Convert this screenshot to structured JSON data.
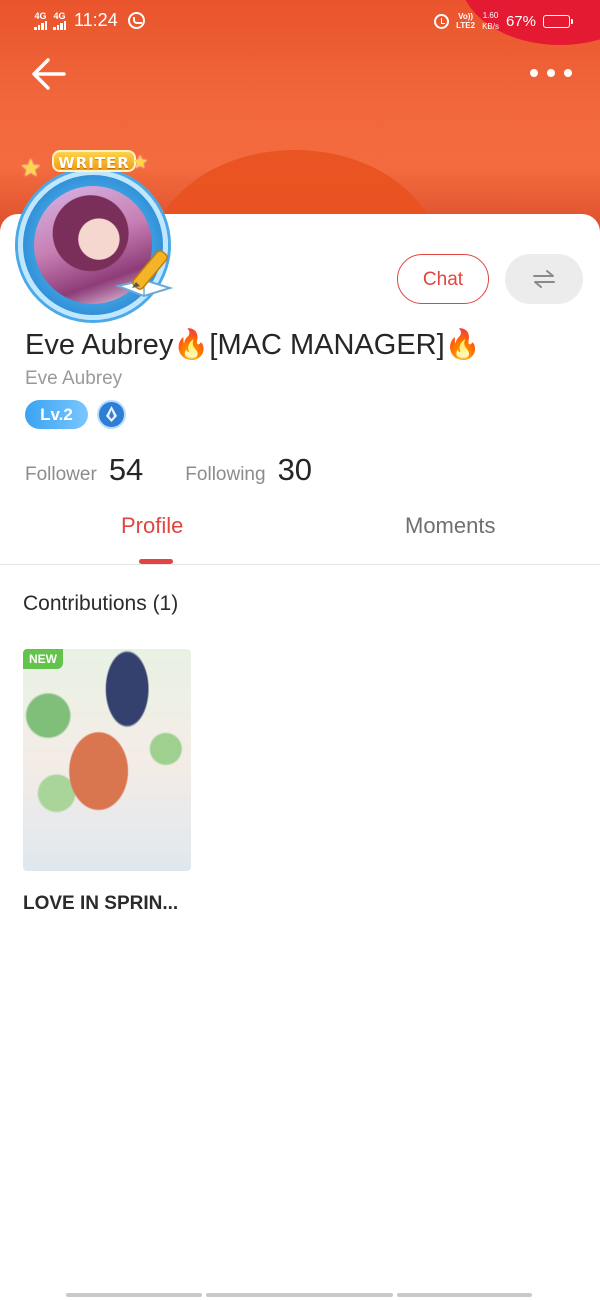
{
  "status_bar": {
    "network1": "4G",
    "network2": "4G",
    "time": "11:24",
    "volte_top": "Vo))",
    "volte_bottom": "LTE2",
    "speed_value": "1.60",
    "speed_unit": "KB/s",
    "battery_percent": "67%",
    "battery_level": 0.67
  },
  "header": {
    "back_icon": "arrow-left-icon",
    "more_icon": "more-dots-icon"
  },
  "profile": {
    "badge_text": "WRITER",
    "display_name": "Eve Aubrey🔥[MAC MANAGER]🔥",
    "username": "Eve Aubrey",
    "level": "Lv.2",
    "chat_label": "Chat",
    "follower_label": "Follower",
    "follower_count": "54",
    "following_label": "Following",
    "following_count": "30"
  },
  "tabs": [
    {
      "label": "Profile",
      "active": true
    },
    {
      "label": "Moments",
      "active": false
    }
  ],
  "contributions": {
    "title": "Contributions (1)",
    "items": [
      {
        "title": "LOVE IN SPRIN...",
        "badge": "NEW"
      }
    ]
  },
  "colors": {
    "accent": "#e0463f",
    "header_orange": "#f2683c",
    "level_blue": "#3aa3f2",
    "new_green": "#63c34c"
  }
}
